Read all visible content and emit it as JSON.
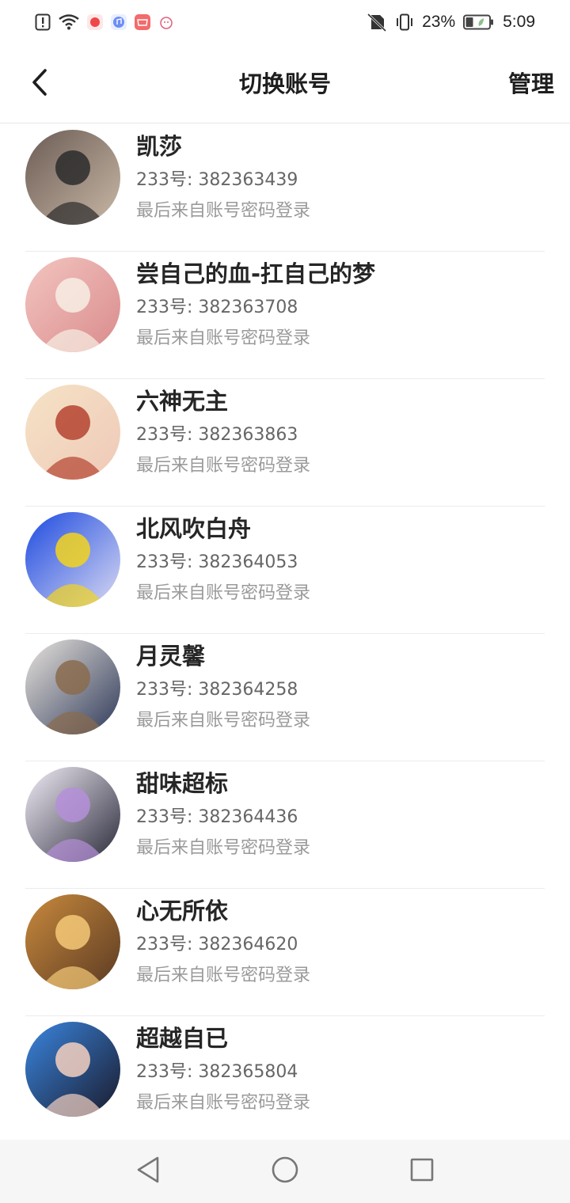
{
  "status_bar": {
    "battery_percent": "23%",
    "time": "5:09",
    "icons_left": [
      "alert-icon",
      "wifi-icon",
      "app-badge-red",
      "app-badge-music",
      "app-badge-store",
      "app-badge-alarm"
    ],
    "icons_right": [
      "no-sim-icon",
      "vibrate-icon",
      "battery-icon"
    ]
  },
  "header": {
    "title": "切换账号",
    "manage_label": "管理",
    "back_icon": "chevron-left-icon"
  },
  "accounts": [
    {
      "name": "凯莎",
      "id_text": "233号: 382363439",
      "login_text": "最后来自账号密码登录",
      "avatar_colors": [
        "#6b5c55",
        "#2b2b2b",
        "#c9b8a6"
      ]
    },
    {
      "name": "尝自己的血-扛自己的梦",
      "id_text": "233号: 382363708",
      "login_text": "最后来自账号密码登录",
      "avatar_colors": [
        "#f3c5c0",
        "#f7efe4",
        "#d98b8c"
      ]
    },
    {
      "name": "六神无主",
      "id_text": "233号: 382363863",
      "login_text": "最后来自账号密码登录",
      "avatar_colors": [
        "#f5e3c6",
        "#b4432f",
        "#efc9b8"
      ]
    },
    {
      "name": "北风吹白舟",
      "id_text": "233号: 382364053",
      "login_text": "最后来自账号密码登录",
      "avatar_colors": [
        "#1d4ae0",
        "#f2d41f",
        "#d9d9f2"
      ]
    },
    {
      "name": "月灵馨",
      "id_text": "233号: 382364258",
      "login_text": "最后来自账号密码登录",
      "avatar_colors": [
        "#e9e4dd",
        "#8a6b4d",
        "#2f3a5a"
      ]
    },
    {
      "name": "甜味超标",
      "id_text": "233号: 382364436",
      "login_text": "最后来自账号密码登录",
      "avatar_colors": [
        "#f3eef8",
        "#b58fd9",
        "#2a2a3a"
      ]
    },
    {
      "name": "心无所依",
      "id_text": "233号: 382364620",
      "login_text": "最后来自账号密码登录",
      "avatar_colors": [
        "#c98a3d",
        "#f4c978",
        "#5a3a22"
      ]
    },
    {
      "name": "超越自已",
      "id_text": "233号: 382365804",
      "login_text": "最后来自账号密码登录",
      "avatar_colors": [
        "#3a86e0",
        "#f4d0c0",
        "#1a1a2a"
      ]
    }
  ],
  "nav_bar": {
    "back_icon": "triangle-back-icon",
    "home_icon": "circle-home-icon",
    "recents_icon": "square-recents-icon"
  }
}
